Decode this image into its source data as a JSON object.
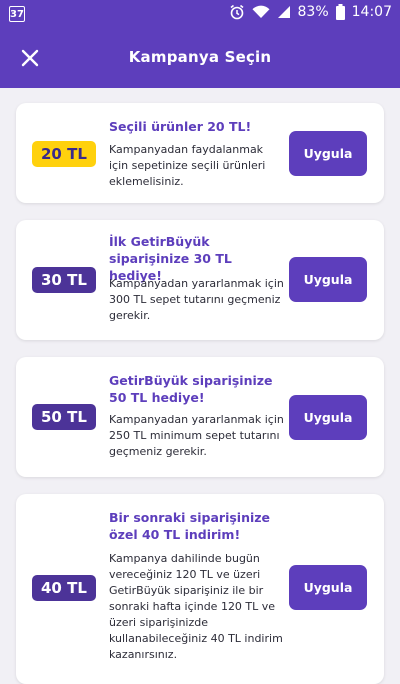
{
  "status_bar": {
    "notification_badge": "37",
    "battery": "83%",
    "time": "14:07"
  },
  "header": {
    "title": "Kampanya Seçin",
    "close_icon": "close-icon"
  },
  "campaigns": [
    {
      "badge": "20 TL",
      "badge_color": "#ffd10d",
      "title": "Seçili ürünler 20 TL!",
      "description": "Kampanyadan faydalanmak için sepetinize seçili ürünleri eklemelisiniz.",
      "button": "Uygula"
    },
    {
      "badge": "30 TL",
      "badge_color": "#4c3398",
      "title": "İlk GetirBüyük siparişinize 30 TL hediye!",
      "description": "Kampanyadan yararlanmak için 300 TL sepet tutarını geçmeniz gerekir.",
      "button": "Uygula"
    },
    {
      "badge": "50 TL",
      "badge_color": "#4c3398",
      "title": "GetirBüyük siparişinize 50 TL hediye!",
      "description": "Kampanyadan yararlanmak için 250 TL minimum sepet tutarını geçmeniz gerekir.",
      "button": "Uygula"
    },
    {
      "badge": "40 TL",
      "badge_color": "#4c3398",
      "title": "Bir sonraki siparişinize özel 40 TL indirim!",
      "description": "Kampanya dahilinde bugün vereceğiniz 120 TL ve üzeri GetirBüyük siparişiniz ile bir sonraki hafta içinde 120 TL ve üzeri siparişinizde kullanabileceğiniz 40 TL indirim kazanırsınız.",
      "button": "Uygula"
    }
  ],
  "colors": {
    "primary": "#5d3ebc",
    "background": "#f1f0f5",
    "accent_yellow": "#ffd10d"
  }
}
